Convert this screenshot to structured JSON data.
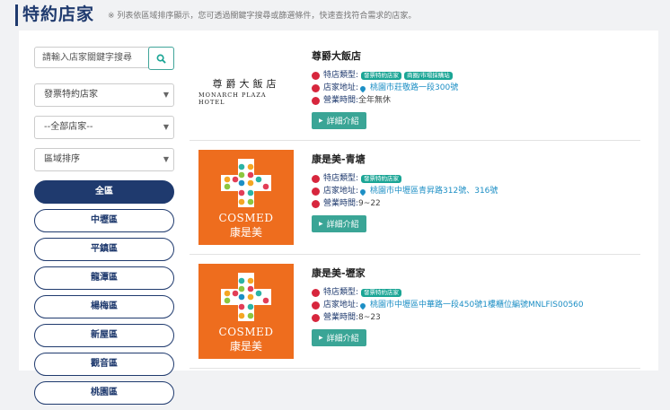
{
  "header": {
    "title": "特約店家",
    "subtitle": "※ 列表依區域排序顯示，您可透過關鍵字搜尋或篩選條件，快速查找符合需求的店家。"
  },
  "sidebar": {
    "search_placeholder": "請輸入店家關鍵字搜尋",
    "select_type": "發票特約店家",
    "select_store": "--全部店家--",
    "select_sort": "區域排序",
    "zones": [
      "全區",
      "中壢區",
      "平鎮區",
      "龍潭區",
      "楊梅區",
      "新屋區",
      "觀音區",
      "桃園區"
    ]
  },
  "labels": {
    "type": "特店類型:",
    "address": "店家地址:",
    "hours": "營業時間:",
    "detail": "詳細介紹"
  },
  "stores": [
    {
      "name": "尊爵大飯店",
      "logo_cn": "尊爵大飯店",
      "logo_en": "MONARCH PLAZA HOTEL",
      "tags": [
        "發票特約店家",
        "商圈/市場採購站"
      ],
      "address": "桃園市莊敬路一段300號",
      "hours": "全年無休"
    },
    {
      "name": "康是美-青塘",
      "logo_en": "COSMED",
      "logo_cn": "康是美",
      "tags": [
        "發票特約店家"
      ],
      "address": "桃園市中壢區青昇路312號、316號",
      "hours": "9~22"
    },
    {
      "name": "康是美-壢家",
      "logo_en": "COSMED",
      "logo_cn": "康是美",
      "tags": [
        "發票特約店家"
      ],
      "address": "桃園市中壢區中華路一段450號1樓櫃位編號MNLFIS00560",
      "hours": "8~23"
    }
  ],
  "colors": {
    "navy": "#1f3a6e",
    "teal": "#1aa595",
    "cosmed_orange": "#ee6d1e",
    "accent_red": "#d7263d"
  }
}
